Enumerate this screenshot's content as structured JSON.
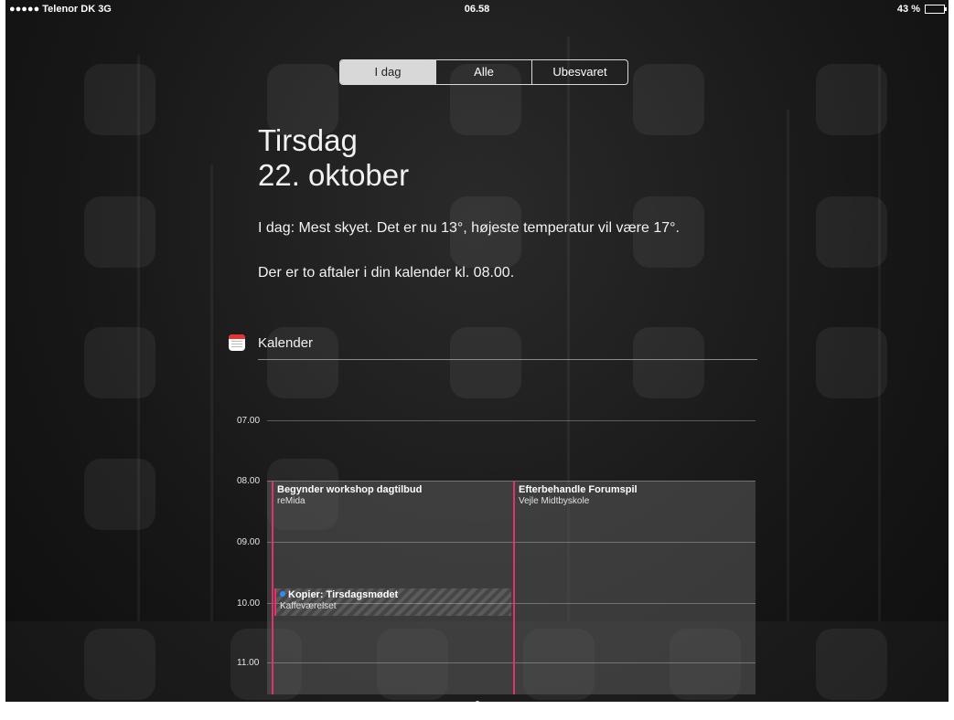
{
  "status_bar": {
    "carrier": "●●●●● Telenor DK  3G",
    "time": "06.58",
    "battery": "43 %",
    "battery_level": 0.43
  },
  "tabs": [
    {
      "label": "I dag",
      "active": true
    },
    {
      "label": "Alle",
      "active": false
    },
    {
      "label": "Ubesvaret",
      "active": false
    }
  ],
  "today": {
    "weekday": "Tirsdag",
    "date": "22. oktober",
    "weather": "I dag: Mest skyet. Det er nu 13°, højeste temperatur vil være 17°.",
    "appointments": "Der er to aftaler i din kalender kl. 08.00."
  },
  "calendar": {
    "title": "Kalender",
    "hours": [
      "07.00",
      "08.00",
      "09.00",
      "10.00",
      "11.00"
    ],
    "events": [
      {
        "title": "Begynder workshop dagtilbud",
        "location": "reMida"
      },
      {
        "title": "Efterbehandle Forumspil",
        "location": "Vejle Midtbyskole"
      },
      {
        "title": "Kopier: Tirsdagsmødet",
        "location": "Kaffeværelset"
      }
    ]
  },
  "colors": {
    "event_accent": "#e0336a",
    "dot": "#2f8cff",
    "segment_active": "#d8d8d8"
  },
  "icons": [
    "calendar-app-icon",
    "pull-up-handle-icon",
    "battery-icon"
  ]
}
